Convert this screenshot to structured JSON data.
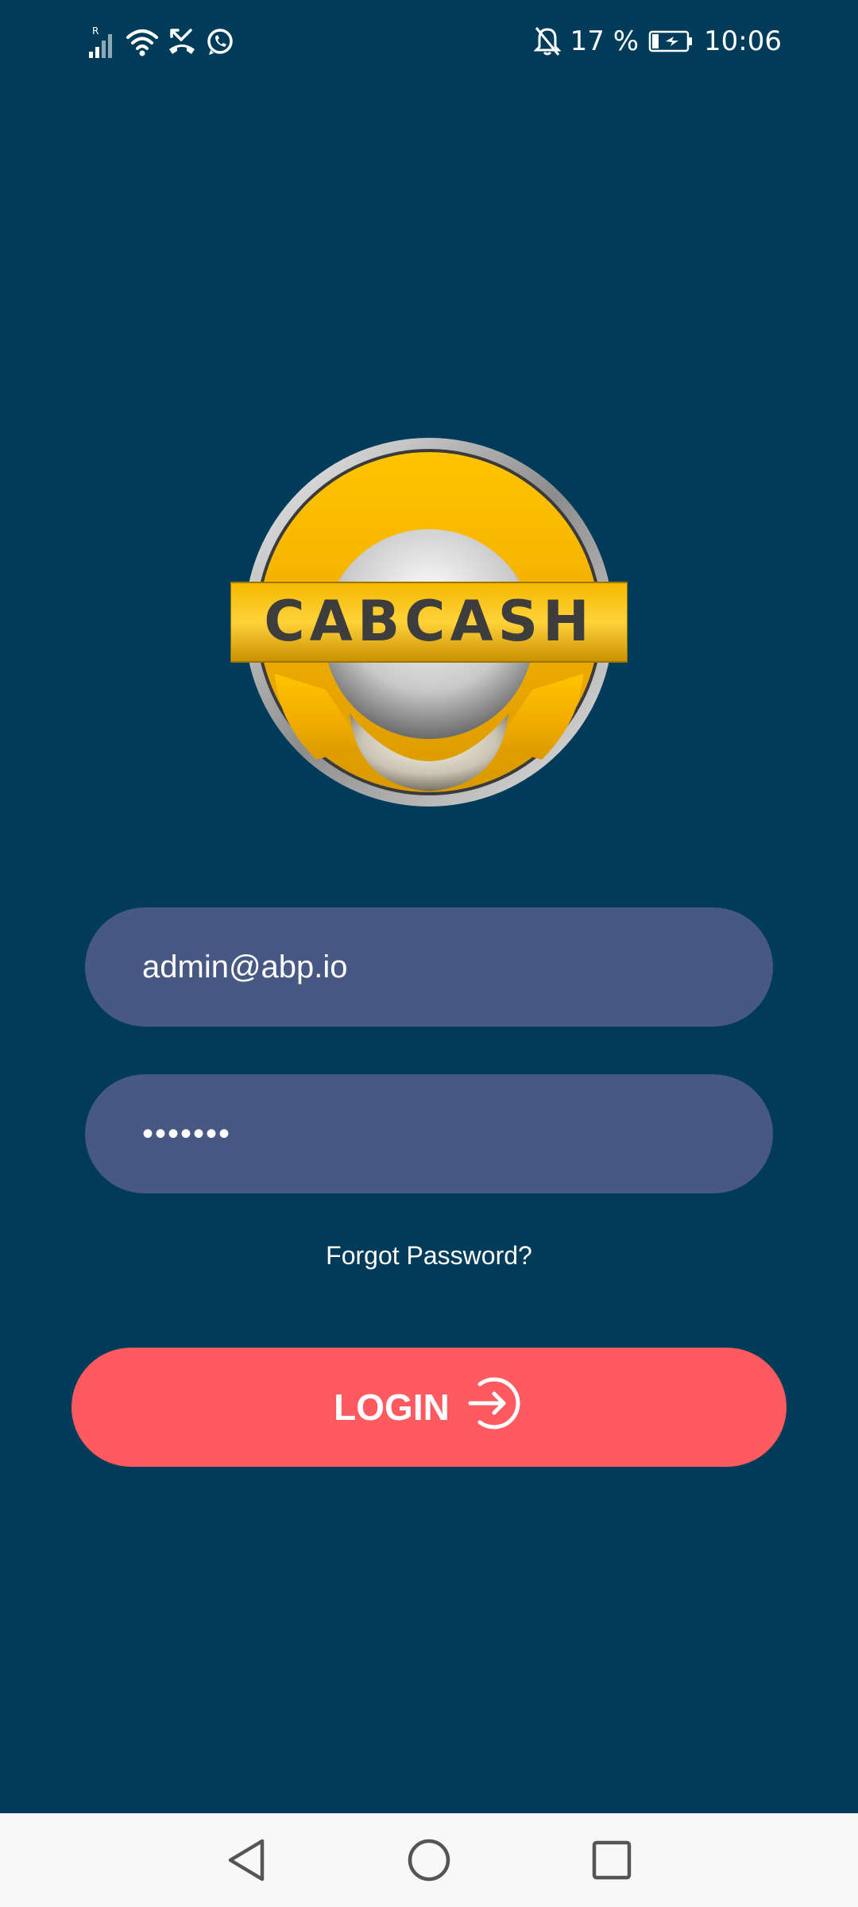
{
  "status_bar": {
    "time": "10:06",
    "battery_percent": "17 %",
    "signal_tag": "R",
    "icons": [
      "signal-icon",
      "wifi-icon",
      "missed-call-icon",
      "whatsapp-icon",
      "bell-off-icon",
      "battery-charging-icon"
    ]
  },
  "logo": {
    "text": "CABCASH"
  },
  "login_form": {
    "email_value": "admin@abp.io",
    "password_value": "•••••••",
    "forgot_password": "Forgot Password?",
    "login_label": "LOGIN",
    "login_icon": "arrow-right-circle-icon"
  },
  "colors": {
    "background": "#003C5A",
    "field_background": "#475882",
    "login_button": "#FF5A5F",
    "logo_gold": "#F9B800"
  },
  "nav_bar": {
    "buttons": [
      "back-icon",
      "home-icon",
      "recents-icon"
    ]
  }
}
